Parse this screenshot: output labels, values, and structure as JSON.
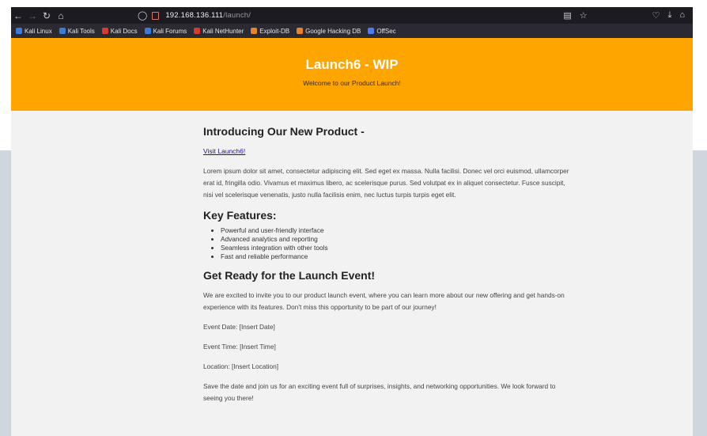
{
  "browser": {
    "url_host": "192.168.136.111",
    "url_path": "/launch/",
    "nav_icons": [
      "back-icon",
      "forward-icon",
      "reload-icon",
      "home-icon"
    ],
    "bookmarks": [
      {
        "label": "Kali Linux",
        "color": "#3a7bd5"
      },
      {
        "label": "Kali Tools",
        "color": "#3a7bd5"
      },
      {
        "label": "Kali Docs",
        "color": "#d33c2f"
      },
      {
        "label": "Kali Forums",
        "color": "#3a7bd5"
      },
      {
        "label": "Kali NetHunter",
        "color": "#d33c2f"
      },
      {
        "label": "Exploit-DB",
        "color": "#e8832a"
      },
      {
        "label": "Google Hacking DB",
        "color": "#e8832a"
      },
      {
        "label": "OffSec",
        "color": "#4c7df0"
      }
    ]
  },
  "hero": {
    "title": "Launch6 - WIP",
    "subtitle": "Welcome to our Product Launch!",
    "bg_color": "#ffa500"
  },
  "intro": {
    "heading": "Introducing Our New Product -",
    "link_text": "Visit Launch6!",
    "body": "Lorem ipsum dolor sit amet, consectetur adipiscing elit. Sed eget ex massa. Nulla facilisi. Donec vel orci euismod, ullamcorper erat id, fringilla odio. Vivamus et maximus libero, ac scelerisque purus. Sed volutpat ex in aliquet consectetur. Fusce suscipit, nisi vel scelerisque venenatis, justo nulla facilisis enim, nec luctus turpis turpis eget elit."
  },
  "features": {
    "heading": "Key Features:",
    "items": [
      "Powerful and user-friendly interface",
      "Advanced analytics and reporting",
      "Seamless integration with other tools",
      "Fast and reliable performance"
    ]
  },
  "event": {
    "heading": "Get Ready for the Launch Event!",
    "invite": "We are excited to invite you to our product launch event, where you can learn more about our new offering and get hands-on experience with its features. Don't miss this opportunity to be part of our journey!",
    "date": "Event Date: [Insert Date]",
    "time": "Event Time: [Insert Time]",
    "location": "Location: [Insert Location]",
    "closing": "Save the date and join us for an exciting event full of surprises, insights, and networking opportunities. We look forward to seeing you there!"
  }
}
